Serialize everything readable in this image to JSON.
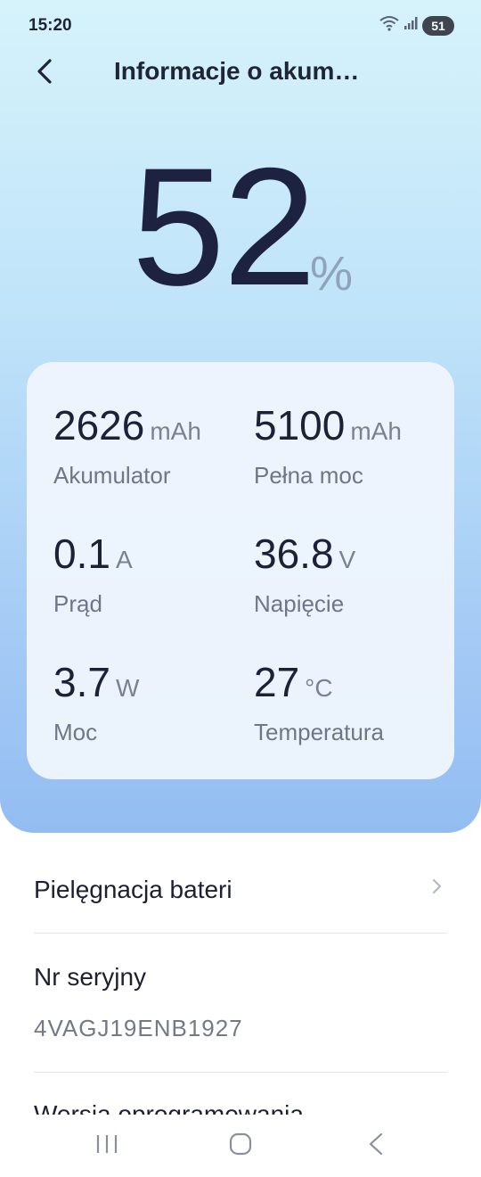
{
  "status_bar": {
    "time": "15:20",
    "battery_level": "51",
    "icons": [
      "wifi-icon",
      "signal-icon",
      "battery-icon"
    ]
  },
  "header": {
    "title": "Informacje o akum…",
    "back_icon": "back-arrow-icon"
  },
  "battery": {
    "percent": "52",
    "unit": "%"
  },
  "stats": [
    {
      "value": "2626",
      "unit": "mAh",
      "label": "Akumulator"
    },
    {
      "value": "5100",
      "unit": "mAh",
      "label": "Pełna moc"
    },
    {
      "value": "0.1",
      "unit": "A",
      "label": "Prąd"
    },
    {
      "value": "36.8",
      "unit": "V",
      "label": "Napięcie"
    },
    {
      "value": "3.7",
      "unit": "W",
      "label": "Moc"
    },
    {
      "value": "27",
      "unit": "°C",
      "label": "Temperatura"
    }
  ],
  "list": {
    "battery_care": "Pielęgnacja bateri",
    "serial_label": "Nr seryjny",
    "serial_value": "4VAGJ19ENB1927",
    "clipped_item": "Wersja oprogramowania"
  },
  "nav": {
    "icons": [
      "recents-icon",
      "home-icon",
      "back-icon"
    ]
  },
  "colors": {
    "hero_top": "#d6f3fb",
    "hero_bottom": "#93bcf2",
    "text_primary": "#1c2136",
    "text_secondary": "#6f7685"
  }
}
